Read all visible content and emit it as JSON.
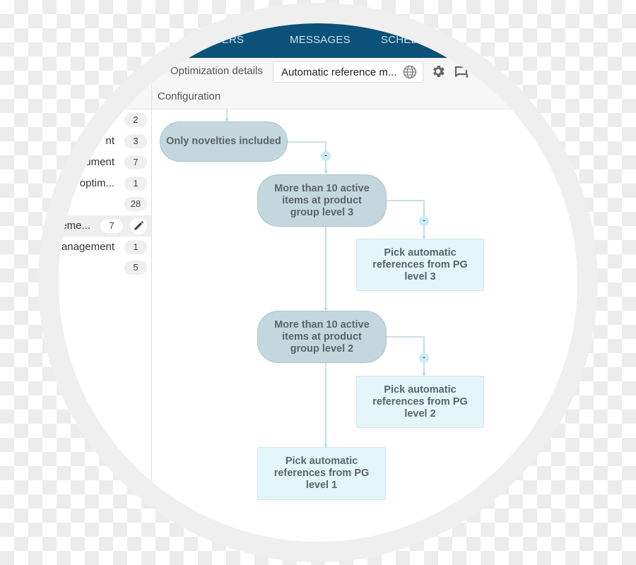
{
  "nav": {
    "tabs": [
      {
        "label": "MEMBERS"
      },
      {
        "label": "MESSAGES"
      },
      {
        "label": "SCHEDULES"
      }
    ]
  },
  "toolbar": {
    "title": "Optimization details",
    "selected_value": "Automatic reference m...",
    "icons": [
      "globe-icon",
      "gear-icon",
      "comment-icon"
    ]
  },
  "config": {
    "header": "Configuration"
  },
  "sidebar": {
    "items": [
      {
        "label": "",
        "count": "2"
      },
      {
        "label": "nt",
        "count": "3"
      },
      {
        "label": "ument",
        "count": "7"
      },
      {
        "label": "cle optim...",
        "count": "1"
      },
      {
        "label": "",
        "count": "28"
      },
      {
        "label": "ageme...",
        "count": "7",
        "active": true
      },
      {
        "label": "anagement",
        "count": "1"
      },
      {
        "label": "",
        "count": "5"
      }
    ]
  },
  "flow": {
    "nodes": [
      {
        "id": "n1",
        "type": "condition",
        "text": "Only novelties included"
      },
      {
        "id": "n2",
        "type": "condition",
        "text": "More than 10 active items at product group level 3"
      },
      {
        "id": "n3",
        "type": "action",
        "text": "Pick automatic references from PG level 3"
      },
      {
        "id": "n4",
        "type": "condition",
        "text": "More than 10 active items at product group level 2"
      },
      {
        "id": "n5",
        "type": "action",
        "text": "Pick automatic references from PG level 2"
      },
      {
        "id": "n6",
        "type": "action",
        "text": "Pick automatic references from PG level 1"
      }
    ],
    "toggle_label": "-"
  },
  "colors": {
    "nav_bg": "#0b5179",
    "condition_fill": "#c4d7df",
    "action_fill": "#e4f6fa",
    "connector": "#b8d4de",
    "toggle_fill": "#c9ecf7"
  }
}
